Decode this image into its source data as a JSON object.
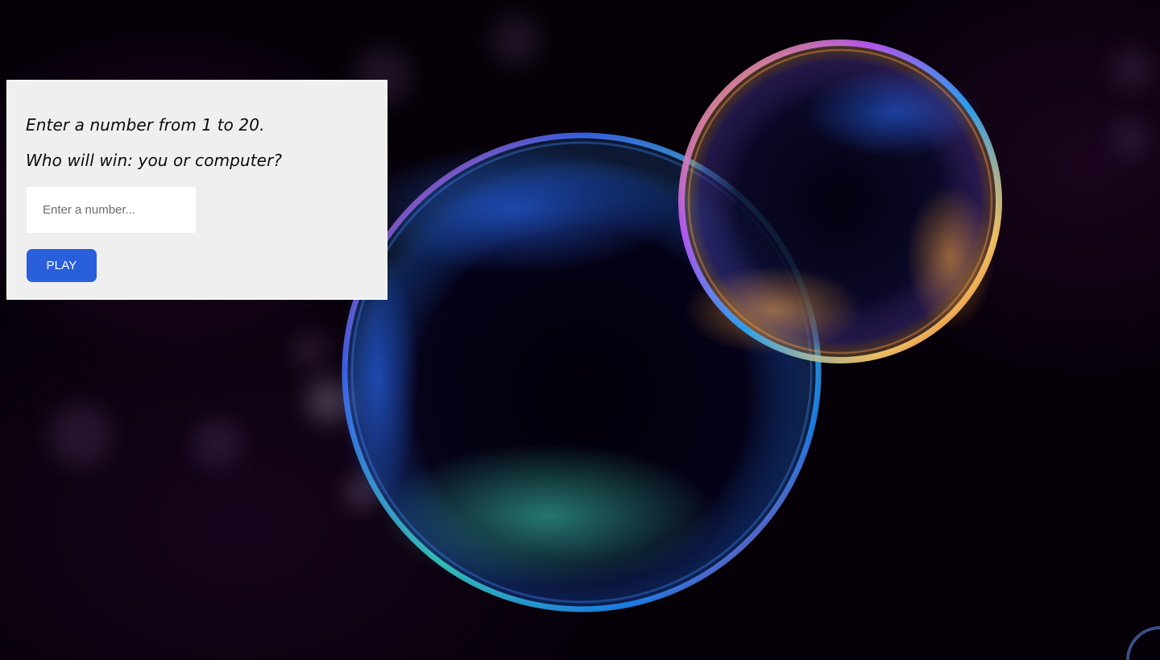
{
  "game": {
    "instruction_line_1": "Enter a number from 1 to 20.",
    "instruction_line_2": "Who will win: you or computer?",
    "input_placeholder": "Enter a number...",
    "input_value": "",
    "play_label": "PLAY"
  },
  "colors": {
    "panel_background": "#efefef",
    "button_accent": "#2a5fdc",
    "page_background": "#060008"
  },
  "icons": {
    "background_image": "soap-bubbles-photo"
  }
}
